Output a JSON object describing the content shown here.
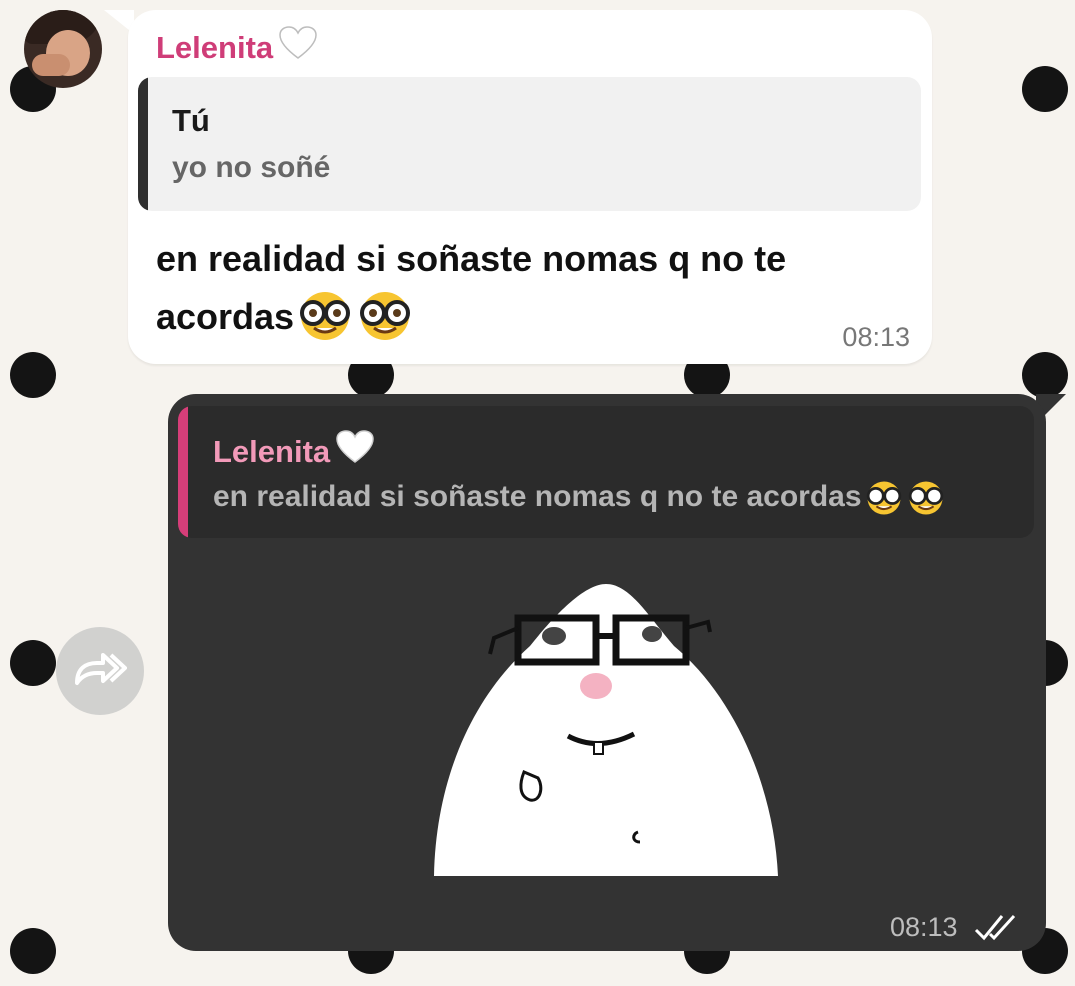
{
  "incoming": {
    "sender": "Lelenita",
    "reply_to": {
      "name": "Tú",
      "text": "yo no soñé"
    },
    "text": "en realidad si soñaste nomas q no te acordas",
    "emojis": [
      "nerd-face",
      "nerd-face"
    ],
    "time": "08:13"
  },
  "outgoing": {
    "reply_to": {
      "name": "Lelenita",
      "text": "en realidad si soñaste nomas q no te acordas"
    },
    "sticker": "nerd-sticker",
    "time": "08:13",
    "status": "read"
  },
  "colors": {
    "sender_name": "#cf3d78",
    "quote_bar_out": "#d63e79",
    "outgoing_bubble": "#333333",
    "incoming_bubble": "#ffffff"
  }
}
